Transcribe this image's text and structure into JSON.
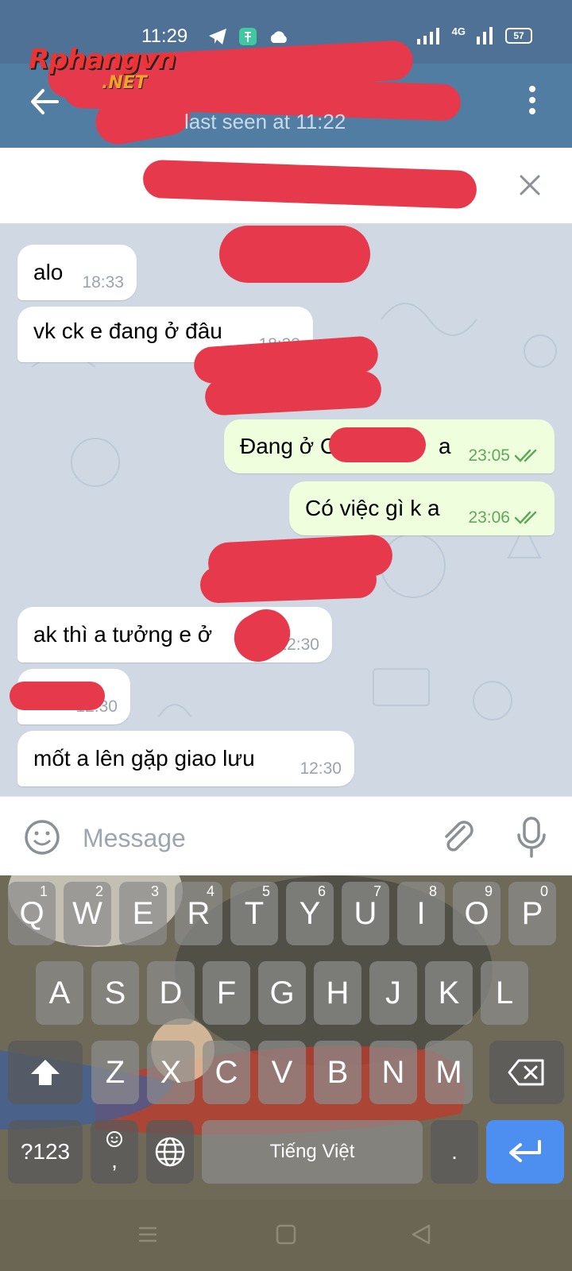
{
  "status_bar": {
    "time": "11:29",
    "network": "4G",
    "battery": "57"
  },
  "watermark": {
    "line1": "Rphangvn",
    "line2": ".NET"
  },
  "header": {
    "status": "last seen at 11:22"
  },
  "messages": [
    {
      "text": "alo",
      "time": "18:33",
      "direction": "in"
    },
    {
      "text": "vk ck e đang ở đâu",
      "time": "18:33",
      "direction": "in"
    },
    {
      "text": "Đang ở C",
      "text_end": "a",
      "time": "23:05",
      "direction": "out"
    },
    {
      "text": "Có việc gì k a",
      "time": "23:06",
      "direction": "out"
    },
    {
      "text": "ak thì a tưởng e ở",
      "time": "12:30",
      "direction": "in"
    },
    {
      "text": "",
      "time": "12:30",
      "direction": "in"
    },
    {
      "text": "mốt a lên gặp giao lưu",
      "time": "12:30",
      "direction": "in"
    }
  ],
  "input": {
    "placeholder": "Message"
  },
  "keyboard": {
    "row1": [
      {
        "k": "Q",
        "h": "1"
      },
      {
        "k": "W",
        "h": "2"
      },
      {
        "k": "E",
        "h": "3"
      },
      {
        "k": "R",
        "h": "4"
      },
      {
        "k": "T",
        "h": "5"
      },
      {
        "k": "Y",
        "h": "6"
      },
      {
        "k": "U",
        "h": "7"
      },
      {
        "k": "I",
        "h": "8"
      },
      {
        "k": "O",
        "h": "9"
      },
      {
        "k": "P",
        "h": "0"
      }
    ],
    "row2": [
      "A",
      "S",
      "D",
      "F",
      "G",
      "H",
      "J",
      "K",
      "L"
    ],
    "row3": [
      "Z",
      "X",
      "C",
      "V",
      "B",
      "N",
      "M"
    ],
    "symbols": "?123",
    "comma": ",",
    "space": "Tiếng Việt",
    "period": "."
  },
  "colors": {
    "header": "#517da2",
    "chat_bg": "#cfd8e3",
    "out_bubble": "#effedd",
    "enter": "#4d8ff0",
    "redaction": "#e63a4c"
  }
}
